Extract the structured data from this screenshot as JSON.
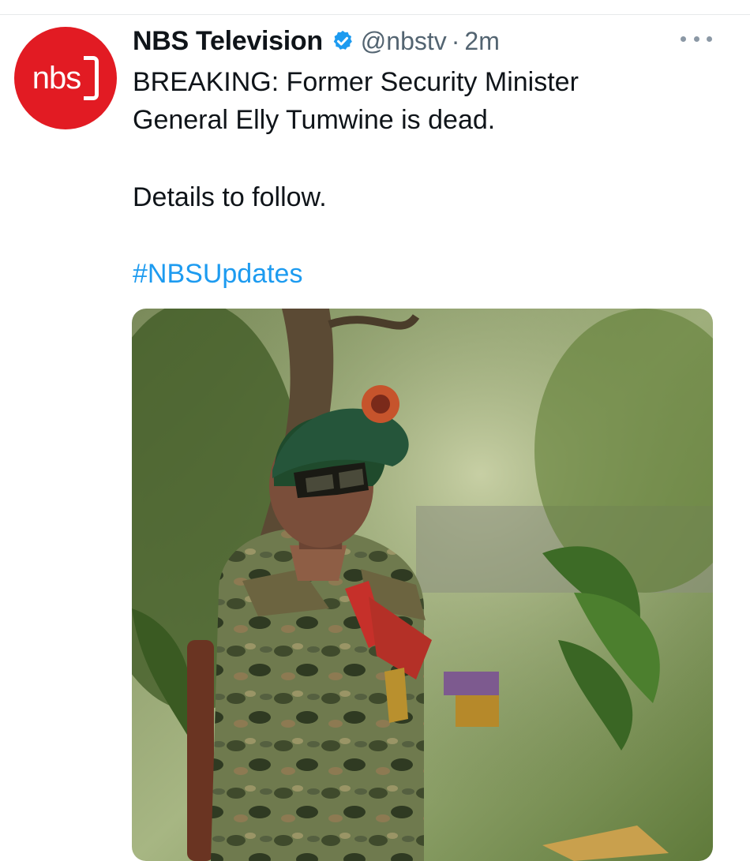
{
  "tweet": {
    "avatar_logo": "nbs",
    "display_name": "NBS Television",
    "verified_icon": "verified-badge-icon",
    "handle": "@nbstv",
    "separator": "·",
    "time": "2m",
    "more_icon": "more-horizontal-icon",
    "text_lines": [
      "BREAKING: Former Security Minister",
      "General Elly Tumwine is dead."
    ],
    "details": "Details to follow.",
    "hashtag": "#NBSUpdates"
  },
  "colors": {
    "brand_red": "#e21b23",
    "link_blue": "#1d9bf0",
    "secondary_text": "#536471",
    "verified_blue": "#1d9bf0"
  }
}
